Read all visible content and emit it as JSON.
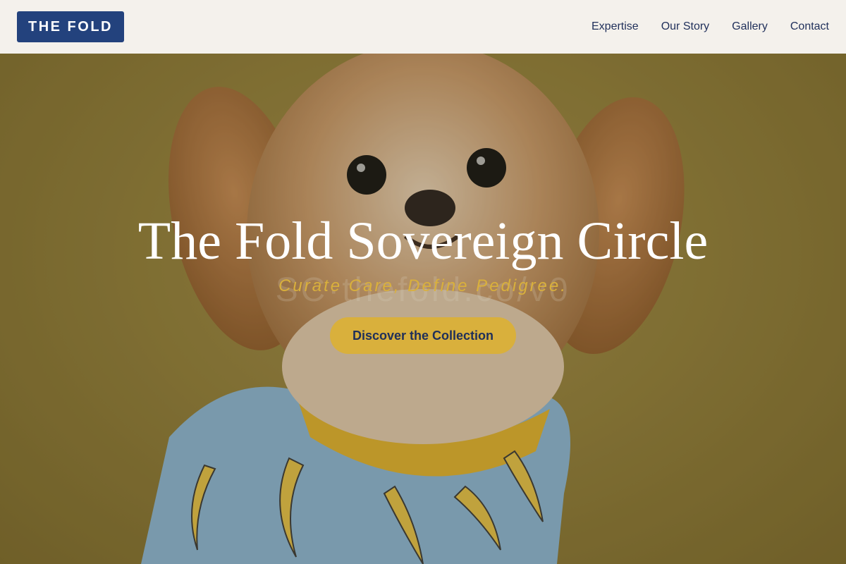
{
  "header": {
    "logo_text": "THE FOLD",
    "nav": [
      {
        "label": "Expertise"
      },
      {
        "label": "Our Story"
      },
      {
        "label": "Gallery"
      },
      {
        "label": "Contact"
      }
    ]
  },
  "hero": {
    "title": "The Fold Sovereign Circle",
    "subtitle": "Curate Care, Define Pedigree.",
    "ghost_text": "SC·thefold.co/v0",
    "cta_label": "Discover the Collection"
  },
  "colors": {
    "brand_navy": "#23427d",
    "accent_gold": "#d9b03c",
    "header_bg": "#f4f1ec",
    "nav_text": "#1f2f5a"
  }
}
